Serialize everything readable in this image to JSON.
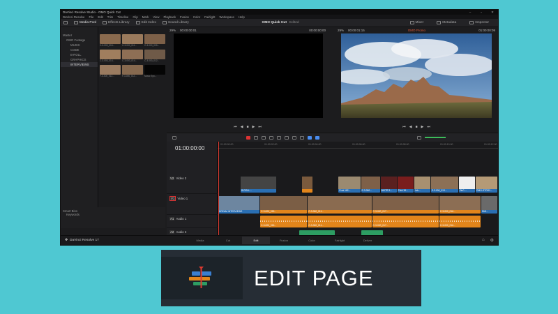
{
  "app": {
    "window_title": "DaVinci Resolve Studio - OMO Quick Cut",
    "menu": [
      "DaVinci Resolve",
      "File",
      "Edit",
      "Trim",
      "Timeline",
      "Clip",
      "Mark",
      "View",
      "Playback",
      "Fusion",
      "Color",
      "Fairlight",
      "Workspace",
      "Help"
    ],
    "toolbar": {
      "media_pool": "Media Pool",
      "effects_library": "Effects Library",
      "edit_index": "Edit Index",
      "sound_library": "Sound Library",
      "project_title": "OMO Quick Cut",
      "project_status": "Edited",
      "mixer": "Mixer",
      "metadata": "Metadata",
      "inspector": "Inspector"
    },
    "sidebar": {
      "items": [
        {
          "label": "Master",
          "level": 0,
          "selected": false
        },
        {
          "label": "OMO Footage",
          "level": 1,
          "selected": false
        },
        {
          "label": "MUSIC",
          "level": 2,
          "selected": false
        },
        {
          "label": "CODE",
          "level": 2,
          "selected": false
        },
        {
          "label": "B-ROLL",
          "level": 2,
          "selected": false
        },
        {
          "label": "GRAPHICS",
          "level": 2,
          "selected": false
        },
        {
          "label": "INTERVIEWS",
          "level": 2,
          "selected": true
        }
      ],
      "smart_bins": "Smart Bins",
      "keywords": "Keywords"
    },
    "media_pool": {
      "clips": [
        {
          "name": "C-3-000_016...",
          "color": "#8a6a4e"
        },
        {
          "name": "C-3-000_011...",
          "color": "#9a7a5c"
        },
        {
          "name": "C-3-000_005...",
          "color": "#7d6048"
        },
        {
          "name": "C-3-000_014...",
          "color": "#a07e5e"
        },
        {
          "name": "C-3-000_014...",
          "color": "#8e6f55"
        },
        {
          "name": "C-3-000_012...",
          "color": "#6f5a48"
        },
        {
          "name": "F-3-000_012...",
          "color": "#9a7b60"
        },
        {
          "name": "F-3-000_012...",
          "color": "#86694f"
        },
        {
          "name": "Music Syn...",
          "color": "#050505"
        }
      ]
    },
    "source_viewer": {
      "zoom": "29%",
      "timecode": "00:00:00:01",
      "right_timecode": "00:00:00:00"
    },
    "program_viewer": {
      "zoom": "29%",
      "timecode": "00:00:01:15",
      "title": "OMO Promo",
      "right_timecode": "01:00:00:09"
    },
    "timeline": {
      "timecode": "01:00:00:00",
      "ruler_ticks": [
        "01:00:00:00",
        "01:00:02:00",
        "01:00:04:00",
        "01:00:06:00",
        "01:00:08:00",
        "01:00:10:00",
        "01:00:12:00"
      ],
      "tracks": {
        "v2": {
          "tag": "V2",
          "name": "Video 2"
        },
        "v1": {
          "tag": "V1",
          "name": "Video 1"
        },
        "a1": {
          "tag": "A1",
          "name": "Audio 1"
        },
        "a2": {
          "tag": "A2",
          "name": "Audio 2"
        }
      },
      "v2_clips": [
        {
          "label": "B-ROLL...",
          "start": 0.08,
          "end": 0.21,
          "color": "#2a6fb3",
          "img": "#444"
        },
        {
          "label": "",
          "start": 0.3,
          "end": 0.34,
          "color": "#e2851b",
          "img": "#7a5a3d"
        },
        {
          "label": "Print 182...",
          "start": 0.43,
          "end": 0.51,
          "color": "#2a6fb3",
          "img": "#9b8a70"
        },
        {
          "label": "E-3-000...",
          "start": 0.51,
          "end": 0.58,
          "color": "#2a6fb3",
          "img": "#7e6048"
        },
        {
          "label": "NIKTR 3...",
          "start": 0.58,
          "end": 0.64,
          "color": "#2a6fb3",
          "img": "#5a2020"
        },
        {
          "label": "Print 18...",
          "start": 0.64,
          "end": 0.7,
          "color": "#2a6fb3",
          "img": "#7a1d1d"
        },
        {
          "label": "Job...",
          "start": 0.7,
          "end": 0.76,
          "color": "#2a6fb3",
          "img": "#a89070"
        },
        {
          "label": "E-3-000_013...",
          "start": 0.76,
          "end": 0.86,
          "color": "#2a6fb3",
          "img": "#8c7056"
        },
        {
          "label": "OkC-...",
          "start": 0.86,
          "end": 0.92,
          "color": "#2a6fb3",
          "img": "#eee"
        },
        {
          "label": "OMO-STORY...",
          "start": 0.92,
          "end": 1.0,
          "color": "#2a6fb3",
          "img": "#b59a76"
        }
      ],
      "v1_clips": [
        {
          "label": "DREAM INTERVIEWS",
          "start": 0.0,
          "end": 0.15,
          "color": "#2a6fb3",
          "img": "#6d86a0"
        },
        {
          "label": "C-3-000_015...",
          "start": 0.15,
          "end": 0.32,
          "color": "#e2851b",
          "img": "#7b5e45"
        },
        {
          "label": "C-3-000_011...",
          "start": 0.32,
          "end": 0.55,
          "color": "#e2851b",
          "img": "#8a6b50"
        },
        {
          "label": "C-3-000_017...",
          "start": 0.55,
          "end": 0.79,
          "color": "#e2851b",
          "img": "#7f6149"
        },
        {
          "label": "C-3-000_016...",
          "start": 0.79,
          "end": 0.94,
          "color": "#e2851b",
          "img": "#8c6e54"
        },
        {
          "label": "DMI...",
          "start": 0.94,
          "end": 1.0,
          "color": "#2a6fb3",
          "img": "#6a6a6a"
        }
      ],
      "a1_clips": [
        {
          "label": "C-3-000_015...",
          "start": 0.15,
          "end": 0.32
        },
        {
          "label": "C-3-000_011...",
          "start": 0.32,
          "end": 0.55
        },
        {
          "label": "C-3-000_017...",
          "start": 0.55,
          "end": 0.79
        },
        {
          "label": "C-3-000_016...",
          "start": 0.79,
          "end": 0.94
        }
      ],
      "a2_clips": [
        {
          "label": "",
          "start": 0.29,
          "end": 0.42
        },
        {
          "label": "",
          "start": 0.51,
          "end": 0.59
        }
      ]
    },
    "pages": [
      "Media",
      "Cut",
      "Edit",
      "Fusion",
      "Color",
      "Fairlight",
      "Deliver"
    ],
    "active_page": "Edit",
    "brand": "DaVinci Resolve 17"
  },
  "banner": {
    "text": "EDIT PAGE"
  },
  "colors": {
    "background": "#4fc8d2",
    "playhead": "#e03a2f",
    "clip_blue": "#2a6fb3",
    "clip_orange": "#e2851b",
    "clip_green": "#2d9d62"
  }
}
